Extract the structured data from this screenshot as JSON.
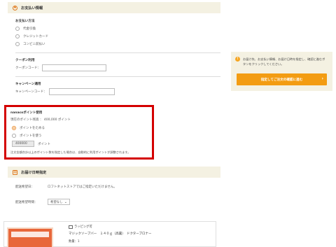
{
  "payment": {
    "section_title": "お支払い情報",
    "method_label": "お支払い方法",
    "options": [
      "代金引換",
      "クレジットカード",
      "コンビニ前払い"
    ]
  },
  "coupon": {
    "heading": "クーポン利用",
    "field_label": "クーポンコード："
  },
  "campaign": {
    "heading": "キャンペーン適用",
    "field_label": "キャンペーンコード："
  },
  "nanaco": {
    "title": "nanacoポイント使用",
    "current_points": "現在のポイント残高 ： 400,000 ポイント",
    "option_use_all": "ポイントをためる",
    "option_use": "ポイントを使う",
    "input_value": "400000",
    "unit": "ポイント",
    "note": "注文金額合計以上のポイント数を指定した場合は、自動的に利用ポイントが調整されます。"
  },
  "delivery": {
    "section_title": "お届け日時指定",
    "date_label": "配送希望日：",
    "date_value": "ロフトネットストアではご指定いただけません。",
    "time_label": "配送希望時間：",
    "time_value": "希望なし"
  },
  "product": {
    "wrapping": "ラッピング可",
    "name": "マジックソープバー　１４０ｇ（高裏）　ドクターブロナー",
    "quantity": "数量：1"
  },
  "sidebar": {
    "info_text": "お届け先、お支払い情報、お届け日時を指定し、確認に進むボタンをクリックしてください。",
    "cta_label": "指定してご注文の確認に進む",
    "cta_arrow": "›"
  },
  "colors": {
    "accent": "#f39c12",
    "highlight_border": "#d40000",
    "section_bg": "#f4f1e2"
  }
}
